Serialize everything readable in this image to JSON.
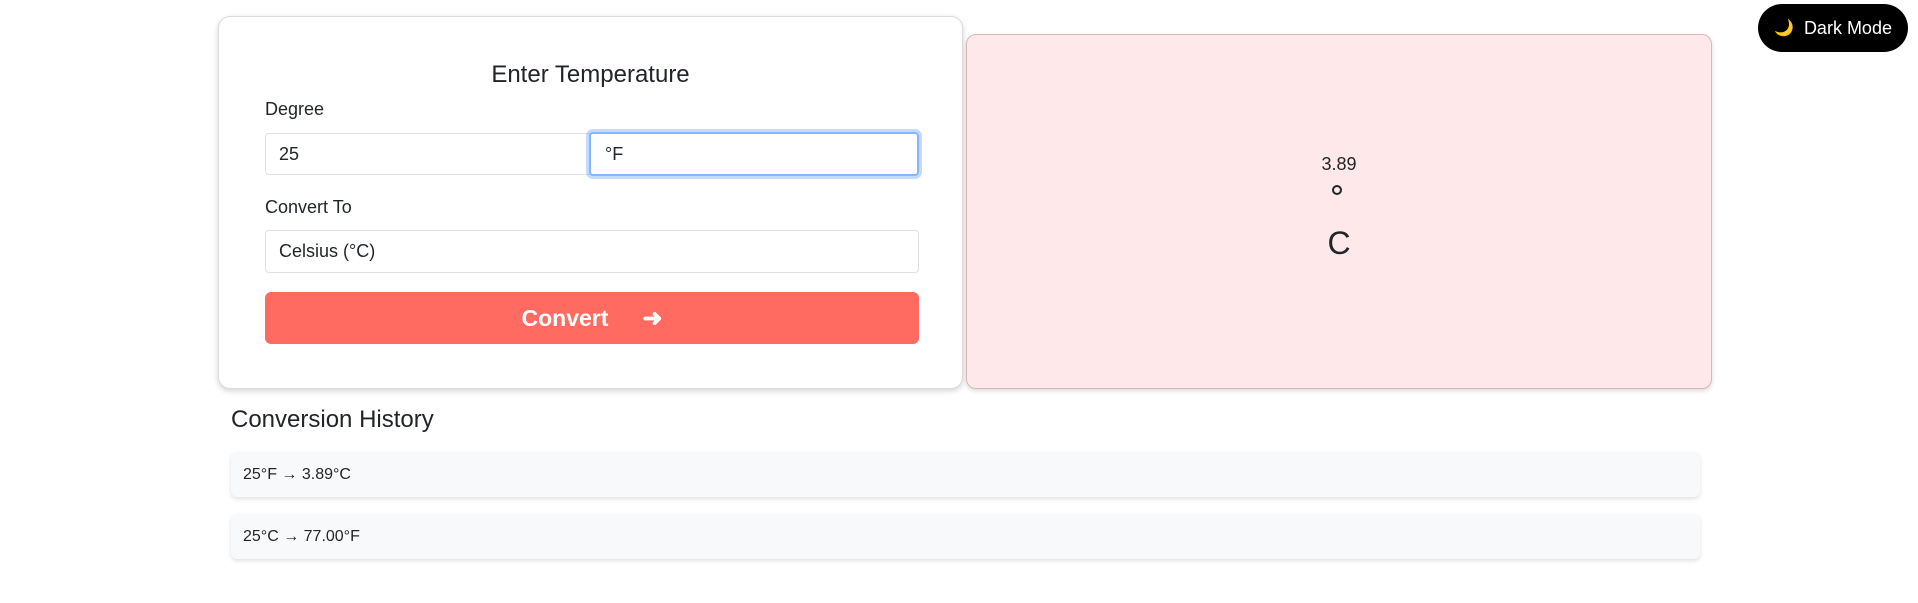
{
  "header": {
    "dark_mode_label": "Dark Mode",
    "moon_icon": "🌙"
  },
  "input_card": {
    "title": "Enter Temperature",
    "degree_label": "Degree",
    "degree_value": "25",
    "unit_value": "°F",
    "convert_to_label": "Convert To",
    "convert_to_value": "Celsius (°C)",
    "convert_button_label": "Convert",
    "convert_button_arrow": "➜"
  },
  "result": {
    "value": "3.89",
    "unit": "C"
  },
  "history": {
    "title": "Conversion History",
    "items": [
      {
        "text": "25°F → 3.89°C"
      },
      {
        "text": "25°C → 77.00°F"
      }
    ]
  },
  "colors": {
    "accent": "#ff6b61",
    "result_bg": "#ffe8ea",
    "focus_border": "#86b7fe",
    "toggle_bg": "#000000"
  }
}
